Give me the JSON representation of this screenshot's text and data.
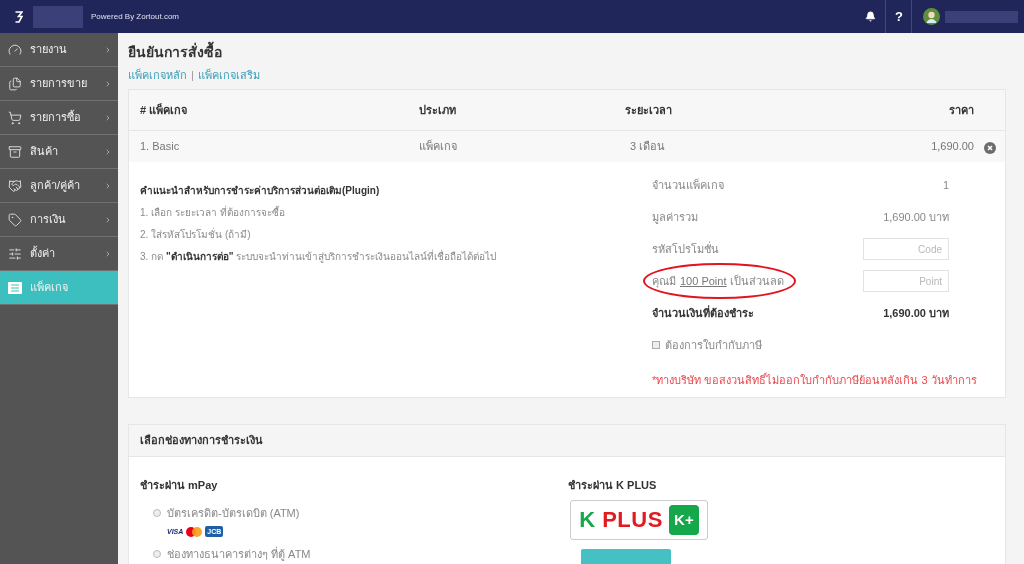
{
  "top_bar": {
    "tagline": "Powered By Zortout.com",
    "help": "?"
  },
  "sidebar": {
    "items": [
      {
        "label": "รายงาน",
        "expandable": true,
        "selected": false
      },
      {
        "label": "รายการขาย",
        "expandable": true,
        "selected": false
      },
      {
        "label": "รายการซื้อ",
        "expandable": true,
        "selected": false
      },
      {
        "label": "สินค้า",
        "expandable": true,
        "selected": false
      },
      {
        "label": "ลูกค้า/คู่ค้า",
        "expandable": true,
        "selected": false
      },
      {
        "label": "การเงิน",
        "expandable": true,
        "selected": false
      },
      {
        "label": "ตั้งค่า",
        "expandable": true,
        "selected": false
      },
      {
        "label": "แพ็คเกจ",
        "expandable": false,
        "selected": true
      }
    ]
  },
  "page": {
    "title": "ยืนยันการสั่งซื้อ",
    "links": [
      {
        "label": "แพ็คเกจหลัก"
      },
      {
        "label": "แพ็คเกจเสริม"
      }
    ],
    "link_separator": "|"
  },
  "order_table": {
    "columns": [
      "# แพ็คเกจ",
      "ประเภท",
      "ระยะเวลา",
      "ราคา"
    ],
    "rows": [
      {
        "cells": [
          "1. Basic",
          "แพ็คเกจ",
          "3 เดือน",
          "1,690.00"
        ]
      }
    ]
  },
  "instructions": {
    "title": "คำแนะนำสำหรับการชำระค่าบริการส่วนต่อเติม(Plugin)",
    "steps": [
      "1. เลือก ระยะเวลา ที่ต้องการจะซื้อ",
      "2. ใส่รหัสโปรโมชั่น (ถ้ามี)",
      "3. กด **\"ดำเนินการต่อ\"** ระบบจะนำท่านเข้าสู่บริการชำระเงินออนไลน์ที่เชื่อถือได้ต่อไป"
    ]
  },
  "summary": [
    {
      "kind": "value",
      "label": "จำนวนแพ็คเกจ",
      "value": "1"
    },
    {
      "kind": "value",
      "label": "มูลค่ารวม",
      "value": "1,690.00 บาท"
    },
    {
      "kind": "input",
      "label": "รหัสโปรโมชั่น",
      "placeholder": "Code"
    },
    {
      "kind": "points",
      "prefix": "คุณมี",
      "link": "100 Point",
      "suffix": "เป็นส่วนลด",
      "placeholder": "Point",
      "highlighted": true
    },
    {
      "kind": "total",
      "label": "จำนวนเงินที่ต้องชำระ",
      "value": "1,690.00 บาท"
    }
  ],
  "tax_invoice": {
    "label": "ต้องการใบกำกับภาษี",
    "checked": false
  },
  "notice": "*ทางบริษัท ขอสงวนสิทธิ์ไม่ออกใบกำกับภาษีย้อนหลังเกิน 3 วันทำการ",
  "payment": {
    "title": "เลือกช่องทางการชำระเงิน",
    "mpay": {
      "heading": "ชำระผ่าน mPay",
      "options": [
        {
          "label": "บัตรเครดิต-บัตรเดบิต (ATM)",
          "selected": false,
          "logos": [
            {
              "kind": "visa",
              "label": "VISA"
            },
            {
              "kind": "mastercard"
            },
            {
              "kind": "jcb",
              "label": "JCB"
            }
          ]
        },
        {
          "label": "ช่องทางธนาคารต่างๆ ที่ตู้ ATM",
          "selected": false
        }
      ]
    },
    "kplus": {
      "heading": "ชำระผ่าน K PLUS",
      "logo_text": "K PLUS",
      "logo_badge": "K+"
    }
  }
}
